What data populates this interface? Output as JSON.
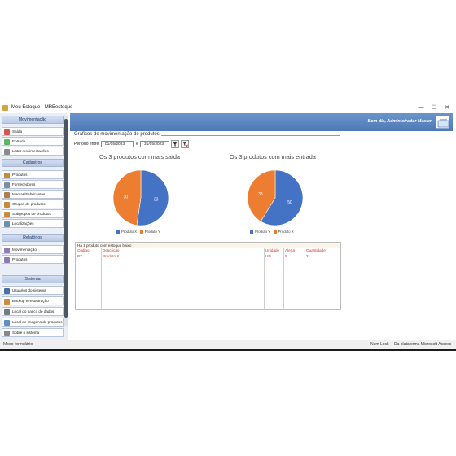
{
  "window": {
    "title": "Meu Estoque - MREestoque",
    "min": "—",
    "max": "☐",
    "close": "✕"
  },
  "sidebar": {
    "sections": [
      {
        "title": "Movimentação",
        "items": [
          {
            "label": "Saída",
            "icon": "exit-icon",
            "color": "#d9534f"
          },
          {
            "label": "Entrada",
            "icon": "entry-icon",
            "color": "#5cb85c"
          },
          {
            "label": "Listar movimentações",
            "icon": "list-icon",
            "color": "#8a8a8a"
          }
        ]
      },
      {
        "title": "Cadastros",
        "items": [
          {
            "label": "Produtos",
            "icon": "products-icon",
            "color": "#c98a3a"
          },
          {
            "label": "Fornecedores",
            "icon": "suppliers-icon",
            "color": "#7a8fa6"
          },
          {
            "label": "Marcas/Fabricantes",
            "icon": "brands-icon",
            "color": "#b07c4a"
          },
          {
            "label": "Grupos de produtos",
            "icon": "groups-icon",
            "color": "#c98a3a"
          },
          {
            "label": "Subgrupos de produtos",
            "icon": "subgroups-icon",
            "color": "#c98a3a"
          },
          {
            "label": "Localizações",
            "icon": "locations-icon",
            "color": "#6b8fb5"
          }
        ]
      },
      {
        "title": "Relatórios",
        "items": [
          {
            "label": "Movimentação",
            "icon": "report-movement-icon",
            "color": "#8c7bb5"
          },
          {
            "label": "Produtos",
            "icon": "report-products-icon",
            "color": "#8c7bb5"
          }
        ]
      },
      {
        "title": "Sistema",
        "items": [
          {
            "label": "Usuários do sistema",
            "icon": "users-icon",
            "color": "#4a6fa5"
          },
          {
            "label": "Backup e restauração",
            "icon": "backup-icon",
            "color": "#d08a3a"
          },
          {
            "label": "Local do banco de dados",
            "icon": "database-icon",
            "color": "#6c7a89"
          },
          {
            "label": "Local de imagens de produtos",
            "icon": "images-icon",
            "color": "#5a8fc8"
          },
          {
            "label": "Sobre o sistema",
            "icon": "about-icon",
            "color": "#888888"
          }
        ]
      }
    ]
  },
  "banner": {
    "greeting": "Bom dia, Administrador Master"
  },
  "main": {
    "section_title": "Gráficos de movimentação de produtos",
    "period_label": "Período entre",
    "date_from": "01/05/2023",
    "connector": "e",
    "date_to": "31/05/2023"
  },
  "chart_data": [
    {
      "type": "pie",
      "title": "Os 3 produtos com mais saída",
      "slices": [
        {
          "label": "Produto X",
          "value": 33,
          "color": "#4472c4"
        },
        {
          "label": "Produto Y",
          "value": 30,
          "color": "#ed7d31"
        }
      ]
    },
    {
      "type": "pie",
      "title": "Os 3 produtos com mais entrada",
      "slices": [
        {
          "label": "Produto Y",
          "value": 50,
          "color": "#4472c4"
        },
        {
          "label": "Produto X",
          "value": 35,
          "color": "#ed7d31"
        }
      ]
    }
  ],
  "low_stock": {
    "header": "Há 1 produto com estoque baixo",
    "columns": [
      "Código",
      "Descrição",
      "Unidade",
      "Alerta",
      "Quantidade"
    ],
    "rows": [
      [
        "PX",
        "Produto X",
        "UN",
        "5",
        "2"
      ]
    ]
  },
  "status": {
    "left": "Modo formulário",
    "numlock": "Num Lock",
    "platform": "Da plataforma Microsoft Access"
  }
}
